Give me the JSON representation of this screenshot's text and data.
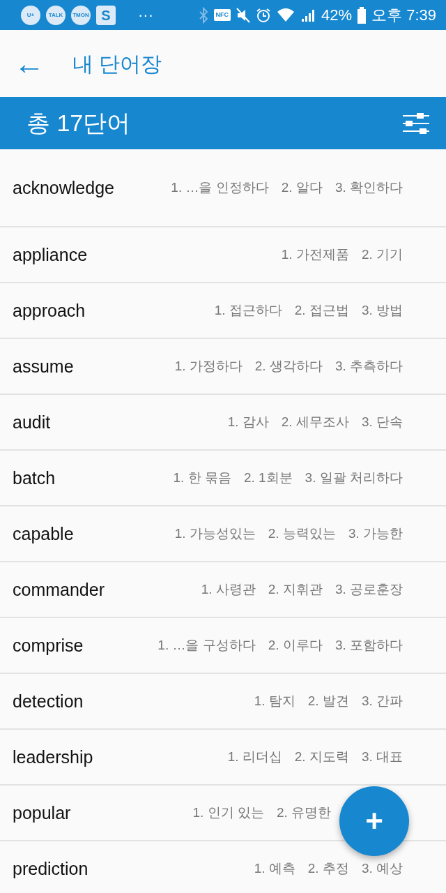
{
  "status_bar": {
    "notification_icons": [
      "U+",
      "TALK",
      "TMON",
      "S"
    ],
    "more": "···",
    "nfc": "NFC",
    "battery": "42%",
    "time": "오후 7:39"
  },
  "app_bar": {
    "back": "←",
    "title": "내 단어장"
  },
  "banner": {
    "total": "총 17단어"
  },
  "words": [
    {
      "word": "acknowledge",
      "meanings": [
        "1. …을 인정하다",
        "2. 알다",
        "3. 확인하다"
      ]
    },
    {
      "word": "appliance",
      "meanings": [
        "1. 가전제품",
        "2. 기기"
      ]
    },
    {
      "word": "approach",
      "meanings": [
        "1. 접근하다",
        "2. 접근법",
        "3. 방법"
      ]
    },
    {
      "word": "assume",
      "meanings": [
        "1. 가정하다",
        "2. 생각하다",
        "3. 추측하다"
      ]
    },
    {
      "word": "audit",
      "meanings": [
        "1. 감사",
        "2. 세무조사",
        "3. 단속"
      ]
    },
    {
      "word": "batch",
      "meanings": [
        "1. 한 묶음",
        "2. 1회분",
        "3. 일괄 처리하다"
      ]
    },
    {
      "word": "capable",
      "meanings": [
        "1. 가능성있는",
        "2. 능력있는",
        "3. 가능한"
      ]
    },
    {
      "word": "commander",
      "meanings": [
        "1. 사령관",
        "2. 지휘관",
        "3. 공로훈장"
      ]
    },
    {
      "word": "comprise",
      "meanings": [
        "1. …을 구성하다",
        "2. 이루다",
        "3. 포함하다"
      ]
    },
    {
      "word": "detection",
      "meanings": [
        "1. 탐지",
        "2. 발견",
        "3. 간파"
      ]
    },
    {
      "word": "leadership",
      "meanings": [
        "1. 리더십",
        "2. 지도력",
        "3. 대표"
      ]
    },
    {
      "word": "popular",
      "meanings": [
        "1. 인기 있는",
        "2. 유명한"
      ]
    },
    {
      "word": "prediction",
      "meanings": [
        "1. 예측",
        "2. 추정",
        "3. 예상"
      ]
    }
  ],
  "fab": {
    "label": "+"
  }
}
